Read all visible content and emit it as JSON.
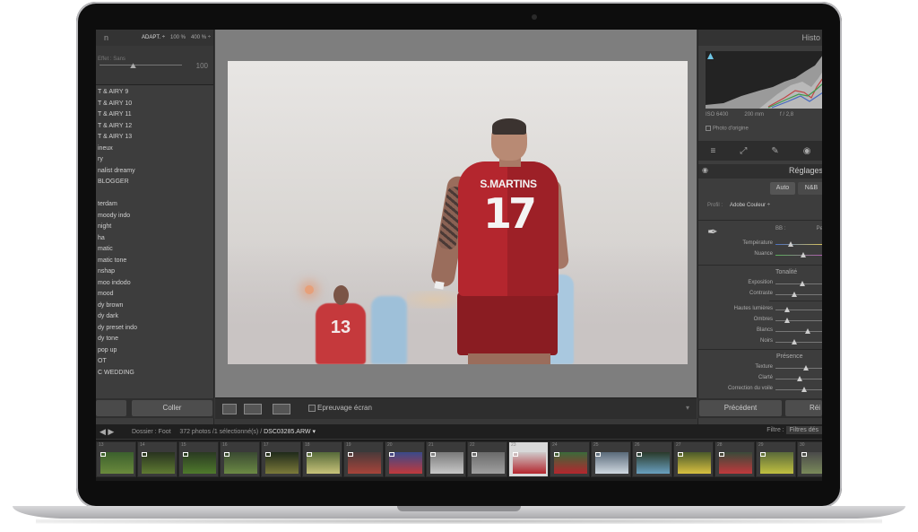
{
  "navigator": {
    "title": "n",
    "zoom_options": [
      "ADAPT. ÷",
      "100 %",
      "400 % ÷"
    ],
    "amount_label": "Effet : Sans",
    "amount_value": "100"
  },
  "presets": [
    "T & AIRY 9",
    "T & AIRY 10",
    "T & AIRY 11",
    "T & AIRY 12",
    "T & AIRY 13",
    "ineux",
    "ry",
    "nalist dreamy",
    "BLOGGER",
    "",
    "terdam",
    "moody indo",
    "night",
    "ha",
    "matic",
    "matic tone",
    "nshap",
    "moo indodo",
    "mood",
    "dy brown",
    "dy dark",
    "dy preset indo",
    "dy tone",
    "pop up",
    "OT",
    "C WEDDING"
  ],
  "left_footer": {
    "copy_label": "",
    "paste_label": "Coller"
  },
  "photo": {
    "main_player_name": "S.MARTINS",
    "main_player_number": "17",
    "bg_player_number": "13"
  },
  "toolbar": {
    "softproof_label": "Epreuvage écran",
    "toggle": "▾"
  },
  "right_panel": {
    "histogram_title": "Histo",
    "iso": "ISO 6400",
    "focal": "200 mm",
    "aperture": "f / 2,8",
    "original_label": "Photo d'origine",
    "tool_icons": [
      "≡",
      "⤢",
      "✎",
      "◉"
    ],
    "reglages_title": "Réglages",
    "auto_label": "Auto",
    "nb_label": "N&B",
    "profile_label": "Profil :",
    "profile_value": "Adobe Couleur ÷",
    "wb_label": "BB :",
    "wb_value": "Pe",
    "temperature_label": "Température",
    "tint_label": "Nuance",
    "tonality_title": "Tonalité",
    "exposure_label": "Exposition",
    "contrast_label": "Contraste",
    "highlights_label": "Hautes lumières",
    "shadows_label": "Ombres",
    "whites_label": "Blancs",
    "blacks_label": "Noirs",
    "presence_title": "Présence",
    "texture_label": "Texture",
    "clarity_label": "Clarté",
    "dehaze_label": "Correction du voile"
  },
  "right_footer": {
    "previous_label": "Précédent",
    "reset_label": "Réi"
  },
  "filmstrip": {
    "folder": "Dossier : Foot",
    "count": "372 photos /1 sélectionné(s) /",
    "file": "DSC03285.ARW ▾",
    "filter_label": "Filtre :",
    "filter_value": "Filtres dés",
    "thumbs": [
      "13",
      "14",
      "15",
      "16",
      "17",
      "18",
      "19",
      "20",
      "21",
      "22",
      "23",
      "24",
      "25",
      "26",
      "27",
      "28",
      "29",
      "30"
    ],
    "selected_index": 10
  },
  "colors": {
    "jersey": "#b4262e",
    "panel": "#3d3d3d",
    "histogram_accent": "#6fc6e6"
  }
}
